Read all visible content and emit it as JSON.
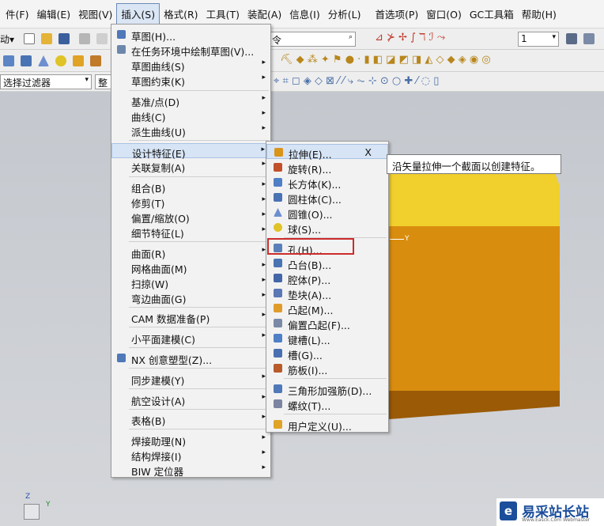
{
  "menubar": {
    "items": [
      "件(F)",
      "编辑(E)",
      "视图(V)",
      "插入(S)",
      "格式(R)",
      "工具(T)",
      "装配(A)",
      "信息(I)",
      "分析(L)",
      "首选项(P)",
      "窗口(O)",
      "GC工具箱",
      "帮助(H)"
    ],
    "active_index": 3
  },
  "toolbar": {
    "start_label": "动▾",
    "command_search_text": "令",
    "layer_value": "1",
    "selection_filter": "选择过滤器",
    "whole_assembly": "整"
  },
  "insert_menu": [
    {
      "label": "草图(H)...",
      "icon": "sketch-icon"
    },
    {
      "label": "在任务环境中绘制草图(V)...",
      "icon": "sketch-task-icon"
    },
    {
      "label": "草图曲线(S)",
      "submenu": true
    },
    {
      "label": "草图约束(K)",
      "submenu": true
    },
    {
      "label": "基准/点(D)",
      "submenu": true
    },
    {
      "label": "曲线(C)",
      "submenu": true
    },
    {
      "label": "派生曲线(U)",
      "submenu": true
    },
    {
      "label": "设计特征(E)",
      "submenu": true,
      "highlighted": true
    },
    {
      "label": "关联复制(A)",
      "submenu": true
    },
    {
      "label": "组合(B)",
      "submenu": true
    },
    {
      "label": "修剪(T)",
      "submenu": true
    },
    {
      "label": "偏置/缩放(O)",
      "submenu": true
    },
    {
      "label": "细节特征(L)",
      "submenu": true
    },
    {
      "label": "曲面(R)",
      "submenu": true
    },
    {
      "label": "网格曲面(M)",
      "submenu": true
    },
    {
      "label": "扫掠(W)",
      "submenu": true
    },
    {
      "label": "弯边曲面(G)",
      "submenu": true
    },
    {
      "label": "CAM 数据准备(P)",
      "submenu": true
    },
    {
      "label": "小平面建模(C)",
      "submenu": true
    },
    {
      "label": "NX 创意塑型(Z)...",
      "icon": "nx-realize-shape-icon"
    },
    {
      "label": "同步建模(Y)",
      "submenu": true
    },
    {
      "label": "航空设计(A)",
      "submenu": true
    },
    {
      "label": "表格(B)",
      "submenu": true
    },
    {
      "label": "焊接助理(N)",
      "submenu": true
    },
    {
      "label": "结构焊接(I)",
      "submenu": true
    },
    {
      "label": "BIW 定位器",
      "submenu": true
    }
  ],
  "design_feature_menu": [
    {
      "label": "拉伸(E)...",
      "icon": "extrude-icon",
      "shortcut": "X"
    },
    {
      "label": "旋转(R)...",
      "icon": "revolve-icon"
    },
    {
      "label": "长方体(K)...",
      "icon": "block-icon"
    },
    {
      "label": "圆柱体(C)...",
      "icon": "cylinder-icon"
    },
    {
      "label": "圆锥(O)...",
      "icon": "cone-icon"
    },
    {
      "label": "球(S)...",
      "icon": "sphere-icon"
    },
    {
      "label": "孔(H)...",
      "icon": "hole-icon",
      "highlighted": true
    },
    {
      "label": "凸台(B)...",
      "icon": "boss-icon"
    },
    {
      "label": "腔体(P)...",
      "icon": "pocket-icon"
    },
    {
      "label": "垫块(A)...",
      "icon": "pad-icon"
    },
    {
      "label": "凸起(M)...",
      "icon": "emboss-icon"
    },
    {
      "label": "偏置凸起(F)...",
      "icon": "offset-emboss-icon"
    },
    {
      "label": "键槽(L)...",
      "icon": "slot-icon"
    },
    {
      "label": "槽(G)...",
      "icon": "groove-icon"
    },
    {
      "label": "筋板(I)...",
      "icon": "rib-icon"
    },
    {
      "label": "三角形加强筋(D)...",
      "icon": "dart-icon"
    },
    {
      "label": "螺纹(T)...",
      "icon": "thread-icon"
    },
    {
      "label": "用户定义(U)...",
      "icon": "user-defined-icon"
    }
  ],
  "tooltip": "沿矢量拉伸一个截面以创建特征。",
  "viewport": {
    "axis_label": "Y"
  },
  "triad": {
    "z": "Z",
    "y": "Y"
  },
  "watermark": {
    "title": "易采站长站",
    "sub": "Www.Easck.Com Webmaster"
  },
  "colors": {
    "block_top": "#f1cf2c",
    "block_front": "#d98d0f",
    "block_bottom": "#9b5a05",
    "highlight_box": "#cc2b2b"
  }
}
